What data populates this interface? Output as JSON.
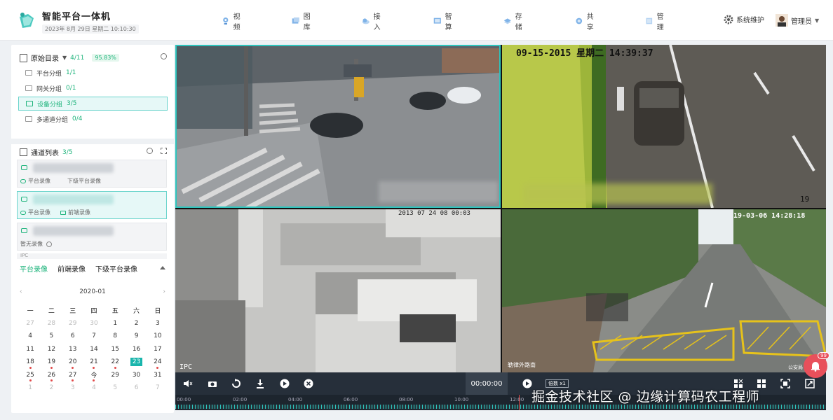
{
  "header": {
    "title": "智能平台一体机",
    "datetime": "2023年 8月 29日  星期二  10:10:30",
    "nav": [
      {
        "label": "视频",
        "icon": "camera-icon"
      },
      {
        "label": "图库",
        "icon": "gallery-icon"
      },
      {
        "label": "接入",
        "icon": "cloud-access-icon"
      },
      {
        "label": "智算",
        "icon": "compute-icon"
      },
      {
        "label": "存储",
        "icon": "storage-icon"
      },
      {
        "label": "共享",
        "icon": "share-icon"
      },
      {
        "label": "管理",
        "icon": "manage-icon"
      }
    ],
    "system_label": "系统维护",
    "user_label": "管理员"
  },
  "catalog": {
    "title": "原始目录",
    "count": "4/11",
    "percent": "95.83%",
    "groups": [
      {
        "label": "平台分组",
        "count": "1/1",
        "active": false
      },
      {
        "label": "网关分组",
        "count": "0/1",
        "active": false
      },
      {
        "label": "设备分组",
        "count": "3/5",
        "active": true
      },
      {
        "label": "多通道分组",
        "count": "0/4",
        "active": false
      }
    ]
  },
  "channels": {
    "title": "通道列表",
    "count": "3/5",
    "items": [
      {
        "tags": [
          "平台录像",
          "下级平台录像"
        ],
        "active": false
      },
      {
        "tags": [
          "平台录像",
          "前端录像"
        ],
        "active": true
      },
      {
        "tags": [
          "暂无录像"
        ],
        "active": false
      }
    ],
    "partial_label": "IPC"
  },
  "record_tabs": [
    "平台录像",
    "前端录像",
    "下级平台录像"
  ],
  "calendar": {
    "month": "2020-01",
    "weekdays": [
      "一",
      "二",
      "三",
      "四",
      "五",
      "六",
      "日"
    ],
    "rows": [
      [
        "27",
        "28",
        "29",
        "30",
        "1",
        "2",
        "3"
      ],
      [
        "4",
        "5",
        "6",
        "7",
        "8",
        "9",
        "10"
      ],
      [
        "11",
        "12",
        "13",
        "14",
        "15",
        "16",
        "17"
      ],
      [
        "18",
        "19",
        "20",
        "21",
        "22",
        "23",
        "24"
      ],
      [
        "25",
        "26",
        "27",
        "今",
        "29",
        "30",
        "31"
      ],
      [
        "1",
        "2",
        "3",
        "4",
        "5",
        "6",
        "7"
      ]
    ],
    "today": "23"
  },
  "videos": [
    {
      "osd": ""
    },
    {
      "osd": "09-15-2015 星期二 14:39:37",
      "corner": "19"
    },
    {
      "osd": "2013 07 24 08 00:03",
      "corner": "IPC"
    },
    {
      "osd": "19-03-06  14:28:18",
      "corner": "勒律外路南",
      "corner2": "公安局"
    }
  ],
  "controls": {
    "time": "00:00:00",
    "speed": "倍数 x1"
  },
  "timeline": {
    "labels": [
      "00:00",
      "02:00",
      "04:00",
      "06:00",
      "08:00",
      "10:00",
      "12:00"
    ]
  },
  "watermark": "掘金技术社区 @ 边缘计算码农工程师",
  "notification_count": "99",
  "colors": {
    "accent": "#1fb47c",
    "teal": "#2ec4bd",
    "alert": "#e8505b"
  }
}
